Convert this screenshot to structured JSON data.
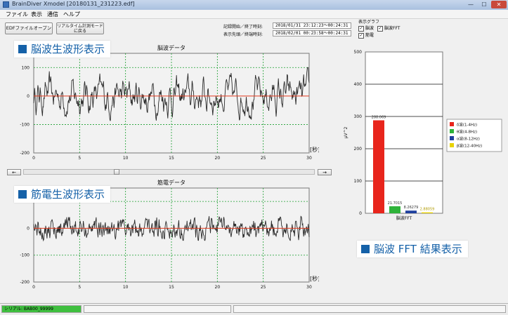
{
  "window": {
    "title": "BrainDiver Xmodel [20180131_231223.edf]",
    "minimize": "—",
    "maximize": "☐",
    "close": "✕"
  },
  "menu": [
    "ファイル",
    "表示",
    "通信",
    "ヘルプ"
  ],
  "toolbar": {
    "edf_open": "EDFファイルオープン",
    "realtime_mode": "リアルタイム計測モードに戻る"
  },
  "record_info": {
    "start_label": "記録開始／終了時刻:",
    "start_value": "2018/01/31 23:12:23～00:24:31",
    "display_label": "表示先頭／終端時刻:",
    "display_value": "2018/02/01 00:23:58～00:24:31"
  },
  "display_graph": {
    "title": "表示グラフ",
    "eeg": {
      "label": "脳波",
      "checked": true
    },
    "fft": {
      "label": "脳波FFT",
      "checked": true
    },
    "emg": {
      "label": "筋電",
      "checked": true
    }
  },
  "callouts": {
    "eeg_raw": "脳波生波形表示",
    "emg_raw": "筋電生波形表示",
    "fft_result": "脳波 FFT 結果表示"
  },
  "scroll": {
    "left_arrow": "←",
    "right_arrow": "→"
  },
  "status": {
    "serial": "シリアル: BAB00_99999"
  },
  "colors": {
    "plot_bg": "#f2f2f2",
    "grid": "#1a9e2e",
    "signal": "#2b2b2b",
    "baseline": "#e23a1e",
    "delta": "#e8251c",
    "theta": "#2eb33a",
    "alpha": "#1f3f9e",
    "beta": "#e8d300",
    "progress": "#3fbf3f"
  },
  "chart_data": [
    {
      "type": "line",
      "title": "脳波データ",
      "xlabel": "[秒]",
      "xlim": [
        0,
        30
      ],
      "ylim": [
        -200,
        150
      ],
      "x_ticks": [
        0,
        5,
        10,
        15,
        20,
        25,
        30
      ],
      "y_ticks": [
        100,
        0,
        -100,
        -200
      ],
      "grid": true,
      "series": [
        {
          "amplitude_range": [
            -100,
            100
          ]
        }
      ]
    },
    {
      "type": "line",
      "title": "筋電データ",
      "xlabel": "[秒]",
      "xlim": [
        0,
        30
      ],
      "ylim": [
        -200,
        150
      ],
      "x_ticks": [
        0,
        5,
        10,
        15,
        20,
        25,
        30
      ],
      "y_ticks": [
        100,
        0,
        -100,
        -200
      ],
      "grid": true,
      "series": [
        {
          "amplitude_range": [
            -45,
            45
          ]
        }
      ]
    },
    {
      "type": "bar",
      "xlabel": "脳波FFT",
      "ylabel": "μV^2",
      "ylim": [
        0,
        500
      ],
      "y_ticks": [
        500,
        400,
        300,
        200,
        100,
        0
      ],
      "legend_position": "right",
      "series": [
        {
          "name": "δ波(1-4Hz)",
          "value": 288.069,
          "label": "288.069"
        },
        {
          "name": "θ波(4-8Hz)",
          "value": 21.7015,
          "label": "21.7015"
        },
        {
          "name": "α波(8-12Hz)",
          "value": 8.26279,
          "label": "8.26279"
        },
        {
          "name": "β波(12-40Hz)",
          "value": 2.88059,
          "label": "2.88059"
        }
      ]
    }
  ]
}
